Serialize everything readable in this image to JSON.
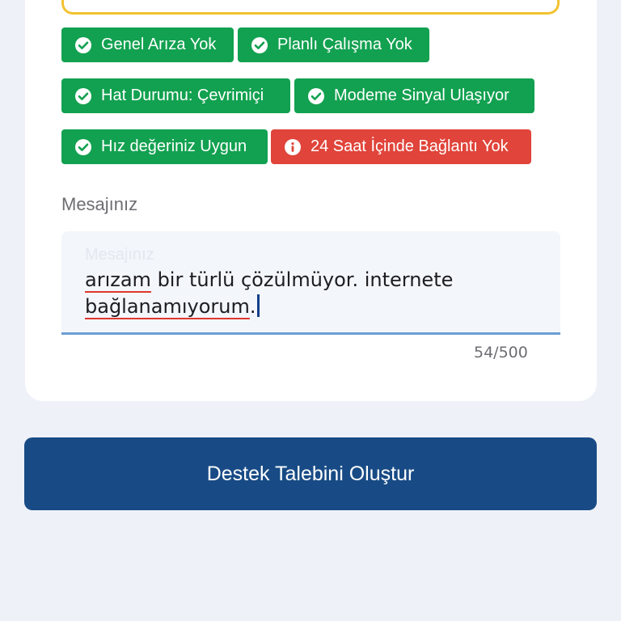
{
  "status_chips": [
    {
      "label": "Genel Arıza Yok",
      "kind": "ok",
      "icon": "check-circle-icon"
    },
    {
      "label": "Planlı Çalışma Yok",
      "kind": "ok",
      "icon": "check-circle-icon"
    },
    {
      "label": "Hat Durumu: Çevrimiçi",
      "kind": "ok",
      "icon": "check-circle-icon"
    },
    {
      "label": "Modeme Sinyal Ulaşıyor",
      "kind": "ok",
      "icon": "check-circle-icon"
    },
    {
      "label": "Hız değeriniz Uygun",
      "kind": "ok",
      "icon": "check-circle-icon"
    },
    {
      "label": "24 Saat İçinde Bağlantı Yok",
      "kind": "warn",
      "icon": "info-circle-icon"
    }
  ],
  "message": {
    "label": "Mesajınız",
    "placeholder": "Mesajınız",
    "word_1": "arızam",
    "text_1": " bir türlü çözülmüyor. internete ",
    "word_2": "bağlanamıyorum",
    "text_2": ".",
    "counter": "54/500"
  },
  "submit_label": "Destek Talebini Oluştur",
  "colors": {
    "ok": "#12a150",
    "warn": "#e0443a",
    "primary": "#184b85",
    "focus_underline": "#6a9fd6",
    "prev_field_border": "#f2c230"
  }
}
